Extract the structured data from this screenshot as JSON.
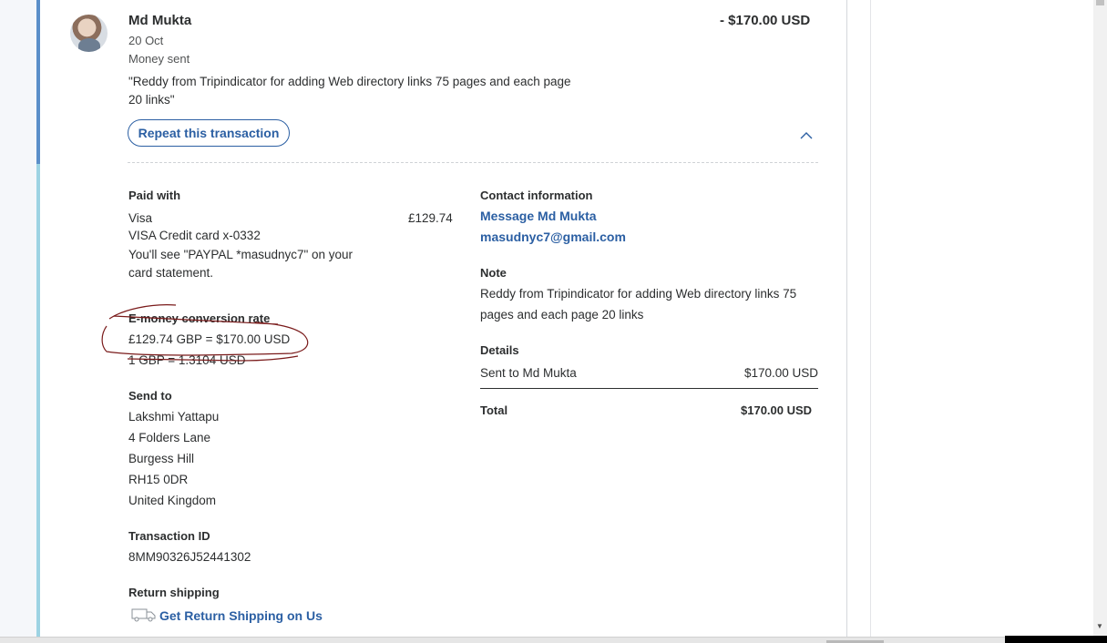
{
  "header": {
    "name": "Md Mukta",
    "date": "20 Oct",
    "type": "Money sent",
    "amount": "- $170.00 USD",
    "description": "\"Reddy from Tripindicator for adding Web directory links 75 pages and each page 20 links\"",
    "repeat_label": "Repeat this transaction"
  },
  "paid_with": {
    "heading": "Paid with",
    "method": "Visa",
    "card": "VISA Credit card x-0332",
    "amount": "£129.74",
    "statement_line1": "You'll see \"PAYPAL *masudnyc7\" on your",
    "statement_line2": "card statement."
  },
  "conversion": {
    "heading": "E-money conversion rate",
    "line1": "£129.74 GBP = $170.00 USD",
    "line2": "1 GBP = 1.3104 USD"
  },
  "send_to": {
    "heading": "Send to",
    "lines": [
      "Lakshmi Yattapu",
      "4 Folders Lane",
      "Burgess Hill",
      "RH15 0DR",
      "United Kingdom"
    ]
  },
  "transaction": {
    "heading": "Transaction ID",
    "id": "8MM90326J52441302"
  },
  "return_shipping": {
    "heading": "Return shipping",
    "link": "Get Return Shipping on Us"
  },
  "contact": {
    "heading": "Contact information",
    "message_link": "Message Md Mukta",
    "email": "masudnyc7@gmail.com"
  },
  "note": {
    "heading": "Note",
    "line1": "Reddy from Tripindicator for adding Web directory links 75",
    "line2": "pages and each page 20 links"
  },
  "details": {
    "heading": "Details",
    "row_label": "Sent to Md Mukta",
    "row_amount": "$170.00 USD",
    "total_label": "Total",
    "total_amount": "$170.00 USD"
  },
  "colors": {
    "link": "#2b5fa3",
    "accent_dark": "#5b8fc9",
    "accent_light": "#9dd3e3",
    "annotation": "#7a1b1b"
  },
  "icons": [
    "avatar",
    "chevron-up-icon",
    "truck-icon"
  ]
}
